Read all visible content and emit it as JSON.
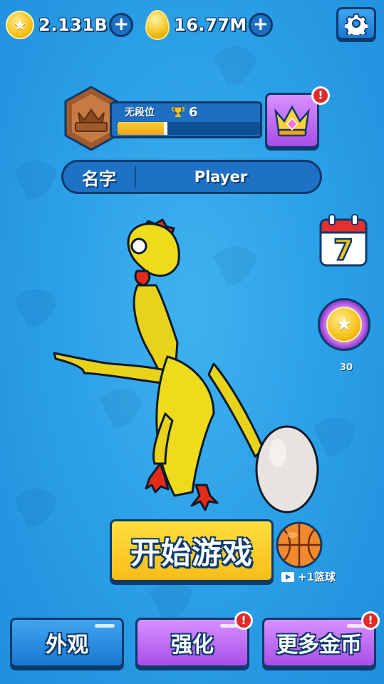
{
  "currencies": {
    "coins": "2.131B",
    "eggs": "16.77M"
  },
  "rank": {
    "title": "无段位",
    "trophies": "6",
    "progress": 0.35
  },
  "profile": {
    "name_label": "名字",
    "name_value": "Player"
  },
  "calendar": {
    "day": "7"
  },
  "wheel": {
    "count": "30"
  },
  "start": {
    "label": "开始游戏",
    "bonus": "+1篮球"
  },
  "bottom": {
    "appearance": "外观",
    "upgrade": "强化",
    "more_coins": "更多金币"
  },
  "alerts": {
    "mark": "!"
  },
  "colors": {
    "background": "#2a9ee6",
    "outline": "#0b3a6b",
    "yellow": "#f8bd1a",
    "purple": "#b25df0",
    "blue_button": "#2f8fe8"
  },
  "icons": [
    "coin-icon",
    "golden-egg-icon",
    "plus-icon",
    "gear-icon",
    "rank-badge-icon",
    "trophy-icon",
    "crown-icon",
    "calendar-icon",
    "coin-wheel-icon",
    "basketball-icon",
    "video-icon",
    "alert-icon"
  ]
}
